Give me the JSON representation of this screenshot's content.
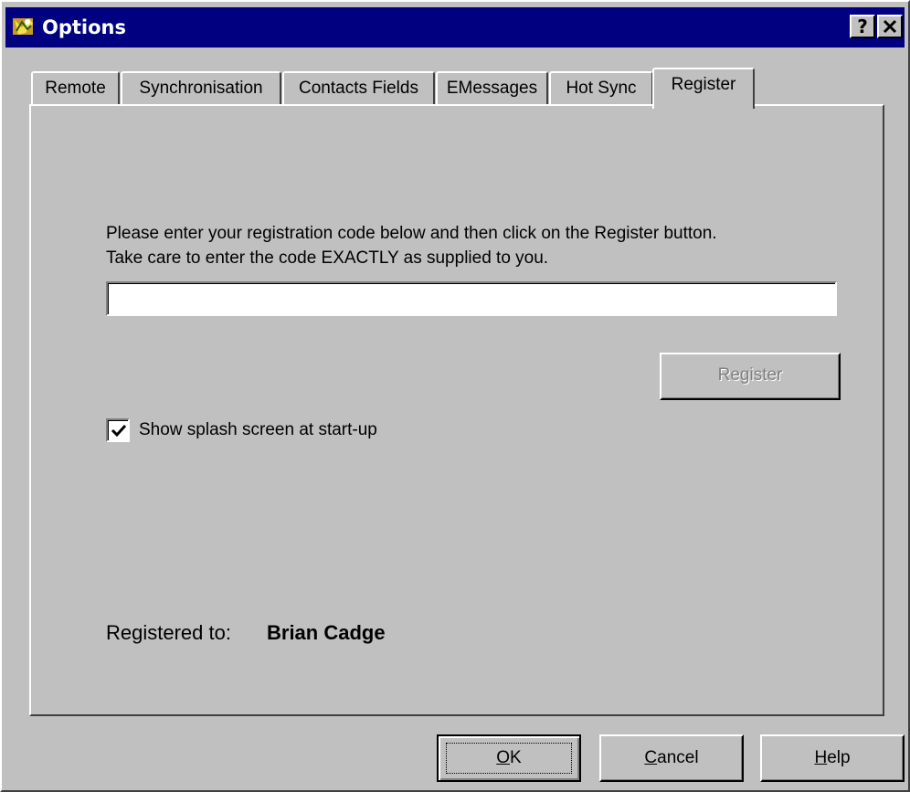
{
  "window": {
    "title": "Options",
    "help_button": "?",
    "close_button": "×"
  },
  "tabs": [
    {
      "label": "Remote",
      "active": false
    },
    {
      "label": "Synchronisation",
      "active": false
    },
    {
      "label": "Contacts Fields",
      "active": false
    },
    {
      "label": "EMessages",
      "active": false
    },
    {
      "label": "Hot Sync",
      "active": false
    },
    {
      "label": "Register",
      "active": true
    }
  ],
  "register_tab": {
    "instruction_line1": "Please enter your registration code below and then click on the Register button.",
    "instruction_line2": "Take care to enter the code EXACTLY as supplied to you.",
    "code_value": "",
    "register_button": {
      "label": "Register",
      "enabled": false
    },
    "splash_checkbox": {
      "label": "Show splash screen at start-up",
      "checked": true
    },
    "registered_label": "Registered to:",
    "registered_name": "Brian Cadge"
  },
  "buttons": {
    "ok": {
      "label": "OK",
      "mnemonic": "O",
      "rest": "K"
    },
    "cancel": {
      "label": "Cancel",
      "mnemonic": "C",
      "rest": "ancel"
    },
    "help": {
      "label": "Help",
      "mnemonic": "H",
      "rest": "elp"
    }
  },
  "colors": {
    "titlebar": "#000080",
    "face": "#c0c0c0",
    "disabled_text": "#808080"
  }
}
